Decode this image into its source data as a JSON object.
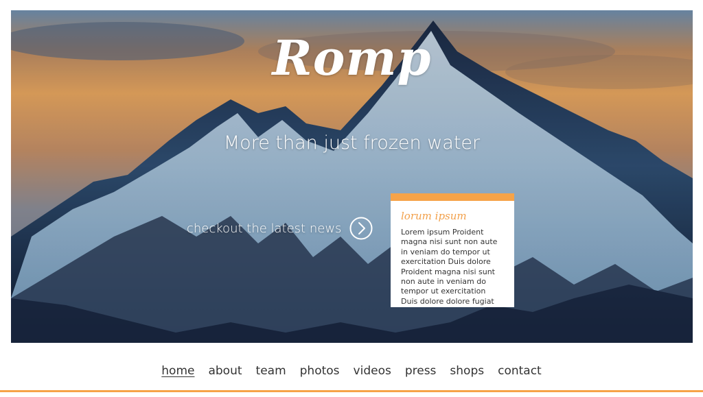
{
  "hero": {
    "logo": "Romp",
    "tagline": "More than just frozen water",
    "cta_label": "checkout the latest news",
    "cta_icon": "chevron-right-circle-icon"
  },
  "news_card": {
    "title": "lorum ipsum",
    "body": "Lorem ipsum Proident magna nisi sunt non aute in veniam do tempor ut exercitation Duis dolore Proident magna nisi sunt non aute in veniam do tempor ut exercitation Duis dolore dolore fugiat",
    "accent_color": "#f6a348"
  },
  "nav": {
    "items": [
      {
        "label": "home",
        "active": true
      },
      {
        "label": "about"
      },
      {
        "label": "team"
      },
      {
        "label": "photos"
      },
      {
        "label": "videos"
      },
      {
        "label": "press"
      },
      {
        "label": "shops"
      },
      {
        "label": "contact"
      }
    ]
  },
  "colors": {
    "accent": "#f6a348",
    "text": "#333333"
  }
}
